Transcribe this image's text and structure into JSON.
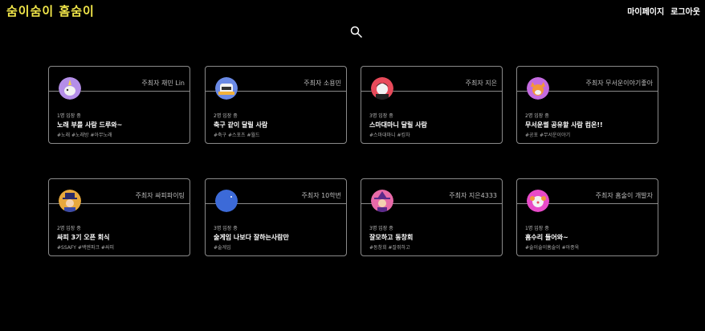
{
  "header": {
    "logo": "숨이숨이 홈숨이",
    "mypage": "마이페이지",
    "logout": "로그아웃"
  },
  "rooms": [
    {
      "host": "주최자 채민 Lin",
      "count": "1명 입장 중",
      "title": "노래 부를 사람 드루와~",
      "tags": "#노래 #노래방 #아무노래",
      "avatar": "unicorn-avatar-icon",
      "color": "#b48ee8"
    },
    {
      "host": "주최자 소용민",
      "count": "2명 입장 중",
      "title": "축구 같이 달릴 사람",
      "tags": "#축구 #스포츠 #월드",
      "avatar": "robot-avatar-icon",
      "color": "#6a8ae6"
    },
    {
      "host": "주최자 지은",
      "count": "3명 입장 중",
      "title": "스마대마니 달릴 사람",
      "tags": "#스마대마니 #킹차",
      "avatar": "vampire-avatar-icon",
      "color": "#e84a5a"
    },
    {
      "host": "주최자 무서운이야기좋아",
      "count": "2명 입장 중",
      "title": "무서운썰 공유할 사람 컴온!!",
      "tags": "#공포 #무서운이야기",
      "avatar": "fox-avatar-icon",
      "color": "#c46ae0"
    },
    {
      "host": "주최자 싸피파이팅",
      "count": "2명 입장 중",
      "title": "싸피 3기 오픈 회식",
      "tags": "#SSAFY #백엔파크 #싸피",
      "avatar": "wizard-avatar-icon",
      "color": "#e8a83c"
    },
    {
      "host": "주최자 10학번",
      "count": "3명 입장 중",
      "title": "술게임 나보다 잘하는사람만",
      "tags": "#술게임",
      "avatar": "moon-avatar-icon",
      "color": "#3c6ad8"
    },
    {
      "host": "주최자 지은4333",
      "count": "3명 입장 중",
      "title": "잘모하고 동창회",
      "tags": "#동창회 #잘쥐하고",
      "avatar": "witch-avatar-icon",
      "color": "#e86aa8"
    },
    {
      "host": "주최자 홈술이 개발자",
      "count": "1명 입장 중",
      "title": "홈수리 들어와~",
      "tags": "#술이술이홈술이 #아종욱",
      "avatar": "clown-avatar-icon",
      "color": "#e84ac8"
    }
  ]
}
